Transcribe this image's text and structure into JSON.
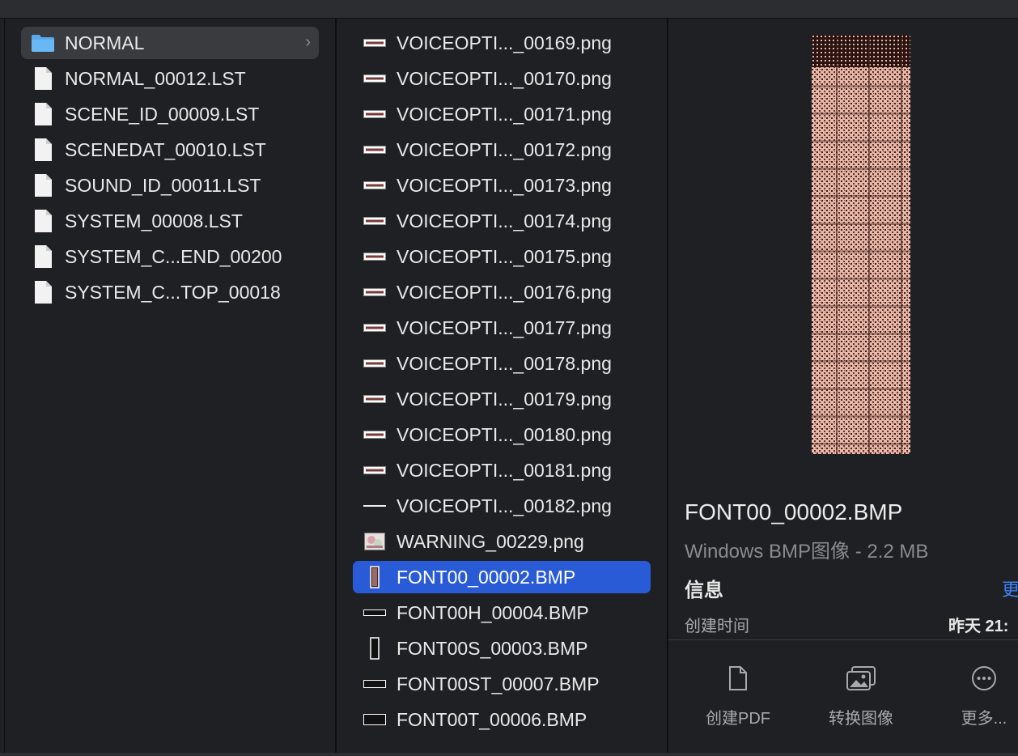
{
  "column1": {
    "items": [
      {
        "label": "NORMAL",
        "icon": "folder-icon",
        "state": "selected-inactive",
        "has_chevron": true
      },
      {
        "label": "NORMAL_00012.LST",
        "icon": "document-icon"
      },
      {
        "label": "SCENE_ID_00009.LST",
        "icon": "document-icon"
      },
      {
        "label": "SCENEDAT_00010.LST",
        "icon": "document-icon"
      },
      {
        "label": "SOUND_ID_00011.LST",
        "icon": "document-icon"
      },
      {
        "label": "SYSTEM_00008.LST",
        "icon": "document-icon"
      },
      {
        "label": "SYSTEM_C...END_00200",
        "icon": "document-icon"
      },
      {
        "label": "SYSTEM_C...TOP_00018",
        "icon": "document-icon"
      }
    ],
    "chevron_glyph": "›"
  },
  "column2": {
    "items": [
      {
        "label": "VOICEOPTI..._00169.png",
        "icon": "wide-image-thumbnail-icon"
      },
      {
        "label": "VOICEOPTI..._00170.png",
        "icon": "wide-image-thumbnail-icon"
      },
      {
        "label": "VOICEOPTI..._00171.png",
        "icon": "wide-image-thumbnail-icon"
      },
      {
        "label": "VOICEOPTI..._00172.png",
        "icon": "wide-image-thumbnail-icon"
      },
      {
        "label": "VOICEOPTI..._00173.png",
        "icon": "wide-image-thumbnail-icon"
      },
      {
        "label": "VOICEOPTI..._00174.png",
        "icon": "wide-image-thumbnail-icon"
      },
      {
        "label": "VOICEOPTI..._00175.png",
        "icon": "wide-image-thumbnail-icon"
      },
      {
        "label": "VOICEOPTI..._00176.png",
        "icon": "wide-image-thumbnail-icon"
      },
      {
        "label": "VOICEOPTI..._00177.png",
        "icon": "wide-image-thumbnail-icon"
      },
      {
        "label": "VOICEOPTI..._00178.png",
        "icon": "wide-image-thumbnail-icon"
      },
      {
        "label": "VOICEOPTI..._00179.png",
        "icon": "wide-image-thumbnail-icon"
      },
      {
        "label": "VOICEOPTI..._00180.png",
        "icon": "wide-image-thumbnail-icon"
      },
      {
        "label": "VOICEOPTI..._00181.png",
        "icon": "wide-image-thumbnail-icon"
      },
      {
        "label": "VOICEOPTI..._00182.png",
        "icon": "thin-line-thumbnail-icon"
      },
      {
        "label": "WARNING_00229.png",
        "icon": "picture-thumbnail-icon"
      },
      {
        "label": "FONT00_00002.BMP",
        "icon": "tall-bitmap-thumbnail-icon",
        "state": "selected"
      },
      {
        "label": "FONT00H_00004.BMP",
        "icon": "wide-bitmap-thumbnail-icon"
      },
      {
        "label": "FONT00S_00003.BMP",
        "icon": "tall-bitmap-thumbnail-icon"
      },
      {
        "label": "FONT00ST_00007.BMP",
        "icon": "wide-bitmap-thumbnail-icon"
      },
      {
        "label": "FONT00T_00006.BMP",
        "icon": "wide-bitmap-thumbnail-icon"
      }
    ]
  },
  "preview": {
    "file_name": "FONT00_00002.BMP",
    "file_type": "Windows BMP图像 - 2.2 MB",
    "info_heading": "信息",
    "more_link": "更",
    "created_label": "创建时间",
    "created_value": "昨天 21:",
    "actions": [
      {
        "label": "创建PDF",
        "icon": "document-icon"
      },
      {
        "label": "转换图像",
        "icon": "photos-icon"
      },
      {
        "label": "更多...",
        "icon": "ellipsis-circle-icon"
      }
    ]
  },
  "colors": {
    "background": "#1f2023",
    "selection_blue": "#2a5bd7",
    "selection_grey": "#3a3b3e",
    "link_blue": "#3b82f6",
    "folder_blue": "#5aa9f0"
  }
}
